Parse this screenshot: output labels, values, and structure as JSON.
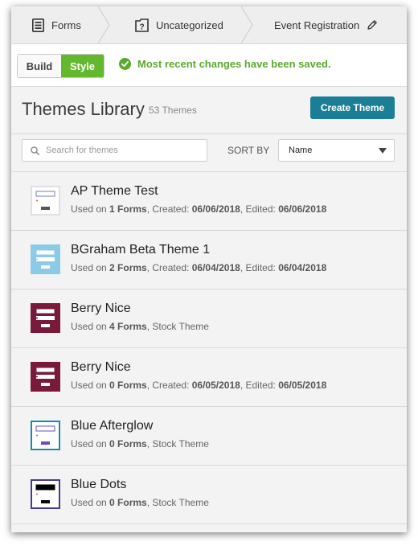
{
  "breadcrumbs": [
    {
      "label": "Forms",
      "icon": "forms-icon"
    },
    {
      "label": "Uncategorized",
      "icon": "folder-question-icon"
    },
    {
      "label": "Event Registration",
      "icon": "pencil-icon"
    }
  ],
  "toolbar": {
    "build_label": "Build",
    "style_label": "Style",
    "status_text": "Most recent changes have been saved.",
    "status_color": "#5aaa2c"
  },
  "header": {
    "title": "Themes Library",
    "count": "53 Themes",
    "create_button": "Create Theme"
  },
  "filters": {
    "search_placeholder": "Search for themes",
    "sort_label": "SORT BY",
    "sort_value": "Name"
  },
  "themes": [
    {
      "name": "AP Theme Test",
      "used_prefix": "Used on ",
      "forms": "1 Forms",
      "sep1": ", Created: ",
      "created": "06/06/2018",
      "sep2": ", Edited: ",
      "edited": "06/06/2018",
      "thumb_bg": "#ffffff",
      "thumb_border": "#e0e0e0",
      "thumb_accent": "#7a7ab8"
    },
    {
      "name": "BGraham Beta Theme 1",
      "used_prefix": "Used on ",
      "forms": "2 Forms",
      "sep1": ", Created: ",
      "created": "06/04/2018",
      "sep2": ", Edited: ",
      "edited": "06/04/2018",
      "thumb_bg": "#8ccbe8",
      "thumb_border": "#8ccbe8",
      "thumb_accent": "#4a90c0"
    },
    {
      "name": "Berry Nice",
      "used_prefix": "Used on ",
      "forms": "4 Forms",
      "sep1": ", ",
      "created": "",
      "sep2": "Stock Theme",
      "edited": "",
      "thumb_bg": "#7a1a3a",
      "thumb_border": "#7a1a3a",
      "thumb_accent": "#ffffff"
    },
    {
      "name": "Berry Nice",
      "used_prefix": "Used on ",
      "forms": "0 Forms",
      "sep1": ", Created: ",
      "created": "06/05/2018",
      "sep2": ", Edited: ",
      "edited": "06/05/2018",
      "thumb_bg": "#7a1a3a",
      "thumb_border": "#7a1a3a",
      "thumb_accent": "#ffffff"
    },
    {
      "name": "Blue Afterglow",
      "used_prefix": "Used on ",
      "forms": "0 Forms",
      "sep1": ", ",
      "created": "",
      "sep2": "Stock Theme",
      "edited": "",
      "thumb_bg": "#ffffff",
      "thumb_border": "#1a8aa8",
      "thumb_accent": "#6a4fb8"
    },
    {
      "name": "Blue Dots",
      "used_prefix": "Used on ",
      "forms": "0 Forms",
      "sep1": ", ",
      "created": "",
      "sep2": "Stock Theme",
      "edited": "",
      "thumb_bg": "#ffffff",
      "thumb_border": "#4a3a8a",
      "thumb_accent": "#000000"
    }
  ]
}
